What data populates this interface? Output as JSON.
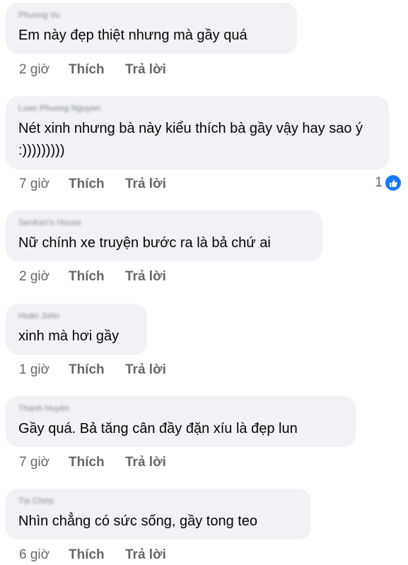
{
  "comments": [
    {
      "author": "Phuong Vu",
      "text": "Em này đẹp thiệt nhưng mà gầy quá",
      "time": "2 giờ",
      "like_label": "Thích",
      "reply_label": "Trả lời"
    },
    {
      "author": "Loan Phuong Nguyen",
      "text": "Nét xinh nhưng bà này kiểu thích bà gầy vậy hay sao ý :)))))))))",
      "time": "7 giờ",
      "like_label": "Thích",
      "reply_label": "Trả lời",
      "reaction_count": "1",
      "reaction_icon": "like-icon"
    },
    {
      "author": "SenKen's House",
      "text": "Nữ chính xe truyện bước ra là bả chứ ai",
      "time": "2 giờ",
      "like_label": "Thích",
      "reply_label": "Trả lời"
    },
    {
      "author": "Hoàn John",
      "text": "xinh mà hơi gầy",
      "time": "1 giờ",
      "like_label": "Thích",
      "reply_label": "Trả lời"
    },
    {
      "author": "Thanh Huyền",
      "text": "Gầy quá. Bả tăng cân đầy đặn xíu là đẹp lun",
      "time": "7 giờ",
      "like_label": "Thích",
      "reply_label": "Trả lời"
    },
    {
      "author": "Tịa Chớp",
      "text": "Nhìn chẳng có sức sống, gầy tong teo",
      "time": "6 giờ",
      "like_label": "Thích",
      "reply_label": "Trả lời"
    }
  ],
  "colors": {
    "bubble": "#f0f2f5",
    "secondary_text": "#65676b",
    "like_blue": "#1877f2"
  }
}
